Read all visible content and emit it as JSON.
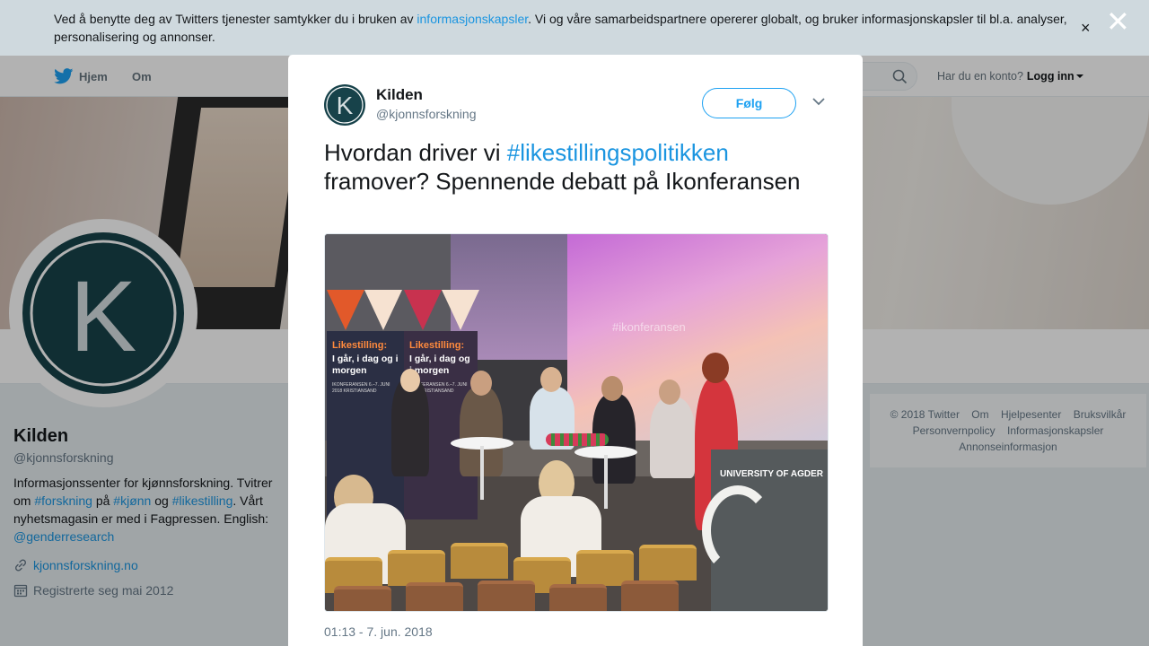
{
  "cookie_banner": {
    "text_before": "Ved å benytte deg av Twitters tjenester samtykker du i bruken av ",
    "link": "informasjonskapsler",
    "text_after": ". Vi og våre samarbeidspartnere opererer globalt, og bruker informasjonskapsler til bl.a. analyser, personalisering og annonser.",
    "close_glyph": "×"
  },
  "modal_close_glyph": "✕",
  "navbar": {
    "home": "Hjem",
    "about": "Om",
    "account_prompt": "Har du en konto?",
    "login": "Logg inn"
  },
  "profile": {
    "name": "Kilden",
    "handle": "@kjonnsforskning",
    "bio": {
      "p1": "Informasjonssenter for kjønnsforskning. Tvitrer om ",
      "h1": "#forskning",
      "p2": " på ",
      "h2": "#kjønn",
      "p3": " og ",
      "h3": "#likestilling",
      "p4": ". Vårt nyhetsmagasin er med i Fagpressen. English: ",
      "mention": "@genderresearch"
    },
    "website": "kjonnsforskning.no",
    "joined": "Registrerte seg mai 2012",
    "avatar_letter": "K"
  },
  "footer": {
    "links": [
      "© 2018 Twitter",
      "Om",
      "Hjelpesenter",
      "Bruksvilkår",
      "Personvernpolicy",
      "Informasjonskapsler",
      "Annonseinformasjon"
    ]
  },
  "tweet": {
    "name": "Kilden",
    "handle": "@kjonnsforskning",
    "follow_label": "Følg",
    "text_1": "Hvordan driver vi ",
    "hashtag": "#likestillingspolitikken",
    "text_2": " framover? Spennende debatt på Ikonferansen",
    "timestamp": "01:13 - 7. jun. 2018",
    "photo": {
      "banner_title": "Likestilling:",
      "banner_sub": "I går, i dag og i morgen",
      "banner_small": "IKONFERANSEN 6.–7. JUNI 2018 KRISTIANSAND",
      "lectern_text": "UNIVERSITY OF AGDER",
      "screen_text": "#ikonferansen"
    }
  },
  "colors": {
    "brand": "#1da1f2",
    "link": "#1b95e0",
    "avatar_dark": "#17424a"
  }
}
